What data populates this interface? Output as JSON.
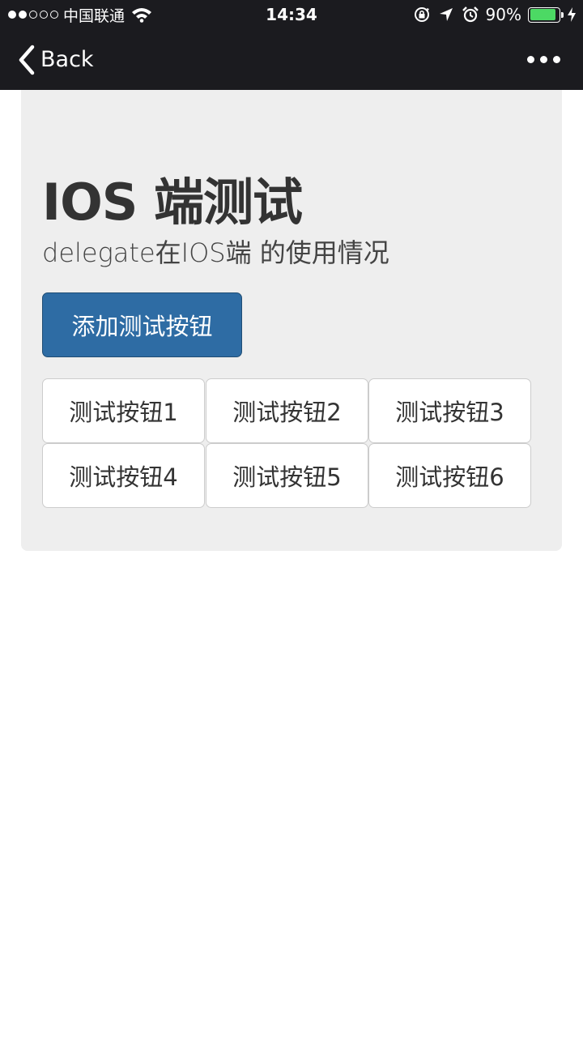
{
  "status_bar": {
    "carrier": "中国联通",
    "time": "14:34",
    "battery_percent": "90%",
    "battery_level": 0.9,
    "battery_color": "#4cd964"
  },
  "nav": {
    "back_label": "Back",
    "more_icon": "more-dots-icon"
  },
  "main": {
    "title": "IOS 端测试",
    "subtitle": "delegate在IOS端 的使用情况",
    "add_button_label": "添加测试按钮",
    "add_button_color": "#2e6ca4",
    "test_buttons": [
      "测试按钮1",
      "测试按钮2",
      "测试按钮3",
      "测试按钮4",
      "测试按钮5",
      "测试按钮6"
    ]
  }
}
